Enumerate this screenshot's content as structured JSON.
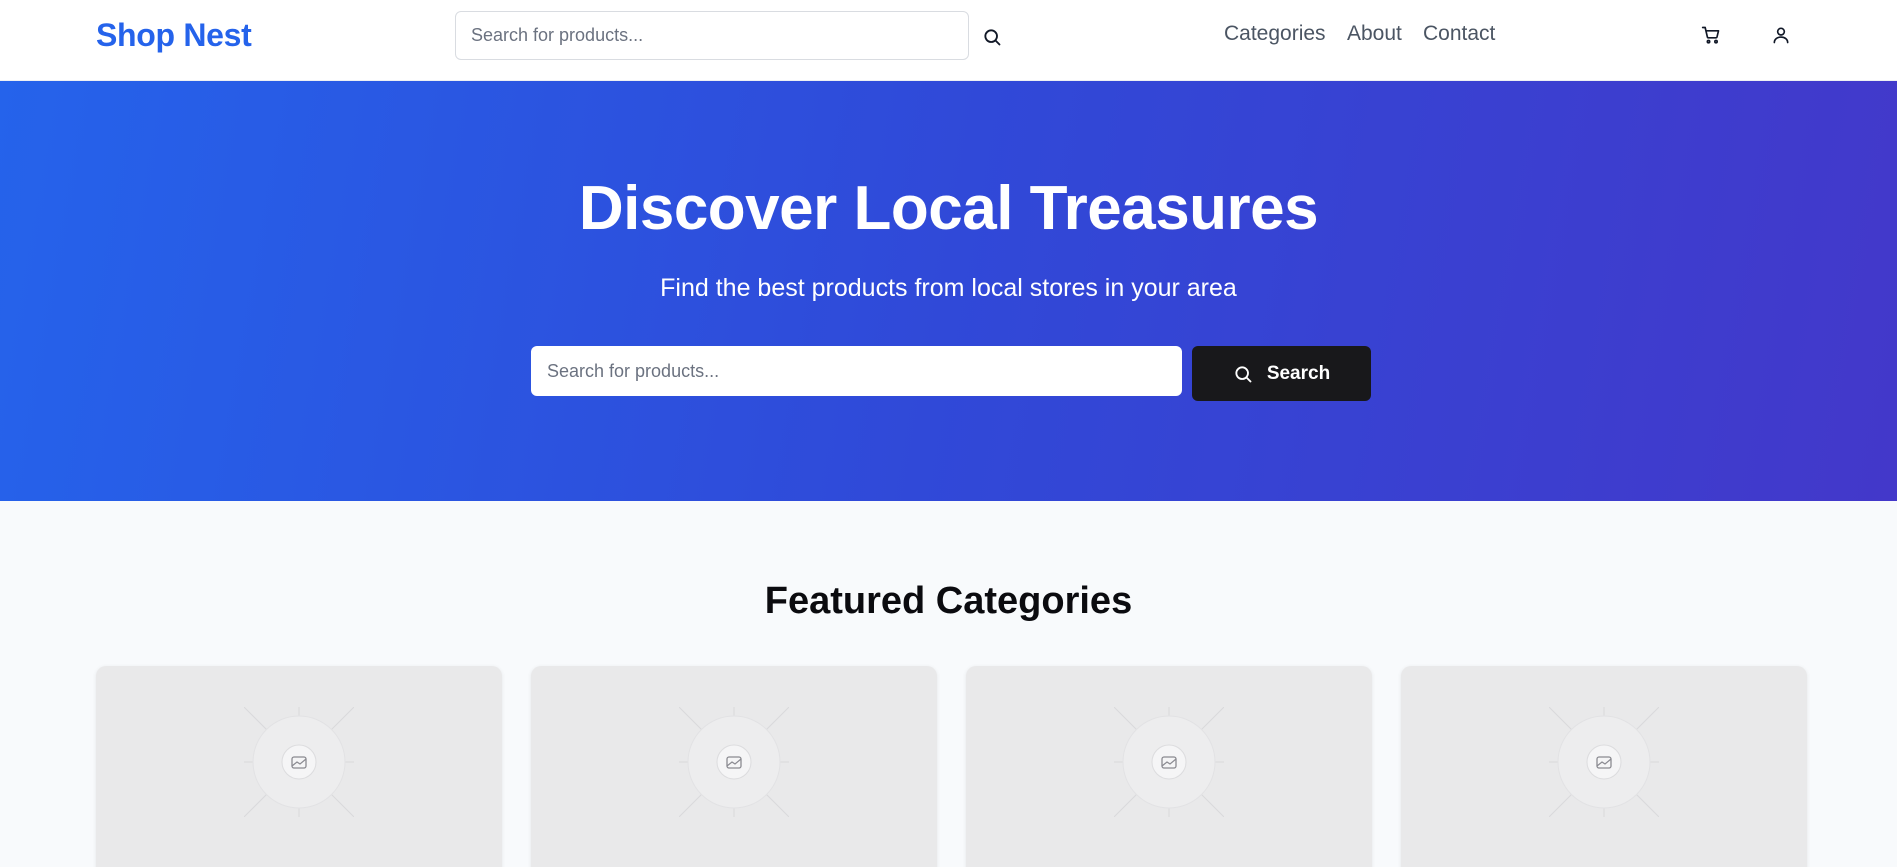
{
  "header": {
    "logo": "Shop Nest",
    "search_placeholder": "Search for products...",
    "nav": [
      "Categories",
      "About",
      "Contact"
    ],
    "search_icon": "search-icon",
    "cart_icon": "shopping-cart-icon",
    "user_icon": "user-icon"
  },
  "hero": {
    "title": "Discover Local Treasures",
    "subtitle": "Find the best products from local stores in your area",
    "search_placeholder": "Search for products...",
    "search_button": "Search"
  },
  "featured": {
    "title": "Featured Categories",
    "card_count_visible": 4,
    "card_image_icon": "image-placeholder-icon"
  },
  "colors": {
    "brand": "#2563eb",
    "hero_gradient_start": "#2563eb",
    "hero_gradient_end": "#4338ca",
    "button_dark": "#18181b"
  }
}
